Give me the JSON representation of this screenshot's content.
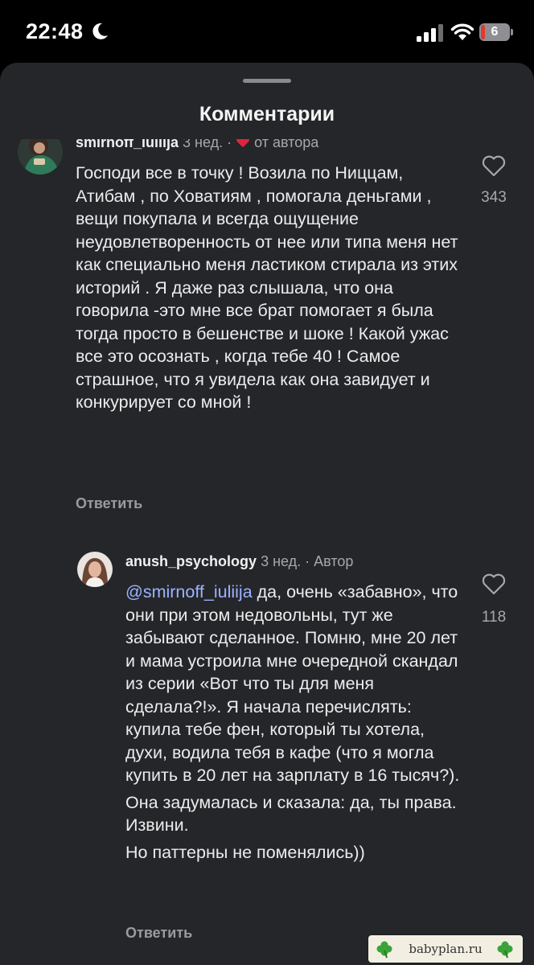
{
  "status_bar": {
    "time": "22:48",
    "battery_level": "6"
  },
  "sheet": {
    "title": "Комментарии"
  },
  "comments": [
    {
      "username": "smirnoff_iuliija",
      "age": "3 нед.",
      "dot": "·",
      "badge": "от автора",
      "text_paragraphs": [
        "Господи все в точку ! Возила по Ниццам, Атибам , по Ховатиям , помогала  деньгами , вещи покупала и всегда ощущение неудовлетворенность от нее или типа меня нет как специально меня ластиком стирала из этих историй . Я даже раз слышала, что она говорила -это мне все брат помогает я была тогда просто в бешенстве и шоке ! Какой ужас все это осознать , когда тебе 40 ! Самое страшное, что я увидела как она завидует и конкурирует со мной !"
      ],
      "reply_label": "Ответить",
      "like_count": "343"
    },
    {
      "username": "anush_psychology",
      "age": "3 нед.",
      "dot": "·",
      "badge": "Автор",
      "mention": "@smirnoff_iuliija",
      "text_paragraphs": [
        " да, очень «забавно», что они при этом недовольны, тут же забывают сделанное. Помню, мне 20 лет и мама устроила мне очередной скандал из серии «Вот что ты для меня сделала?!». Я начала перечислять: купила тебе фен, который ты хотела, духи, водила тебя в кафе (что я могла купить в 20 лет на зарплату в 16 тысяч?).",
        "Она задумалась и сказала: да, ты права. Извини.",
        "Но паттерны не поменялись))"
      ],
      "reply_label": "Ответить",
      "like_count": "118"
    }
  ],
  "watermark": {
    "text": "babyplan.ru"
  },
  "colors": {
    "sheet_bg": "#25262a",
    "mention": "#9bb3ff",
    "heart_red": "#e0243c"
  }
}
